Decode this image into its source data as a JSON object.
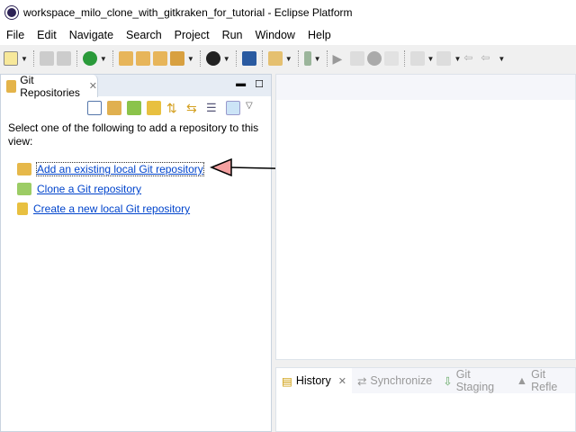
{
  "window": {
    "title": "workspace_milo_clone_with_gitkraken_for_tutorial - Eclipse Platform"
  },
  "menu": [
    "File",
    "Edit",
    "Navigate",
    "Search",
    "Project",
    "Run",
    "Window",
    "Help"
  ],
  "git_view": {
    "tab_label": "Git Repositories",
    "instruction": "Select one of the following to add a repository to this view:",
    "links": [
      {
        "label": "Add an existing local Git repository",
        "icon": "folder-repo-icon"
      },
      {
        "label": "Clone a Git repository",
        "icon": "clone-repo-icon"
      },
      {
        "label": "Create a new local Git repository",
        "icon": "new-repo-icon"
      }
    ]
  },
  "bottom_tabs": [
    {
      "label": "History",
      "active": true
    },
    {
      "label": "Synchronize",
      "active": false
    },
    {
      "label": "Git Staging",
      "active": false
    },
    {
      "label": "Git Refle",
      "active": false
    }
  ],
  "colors": {
    "arrow": "#f4a0a0",
    "link": "#0044cc"
  }
}
